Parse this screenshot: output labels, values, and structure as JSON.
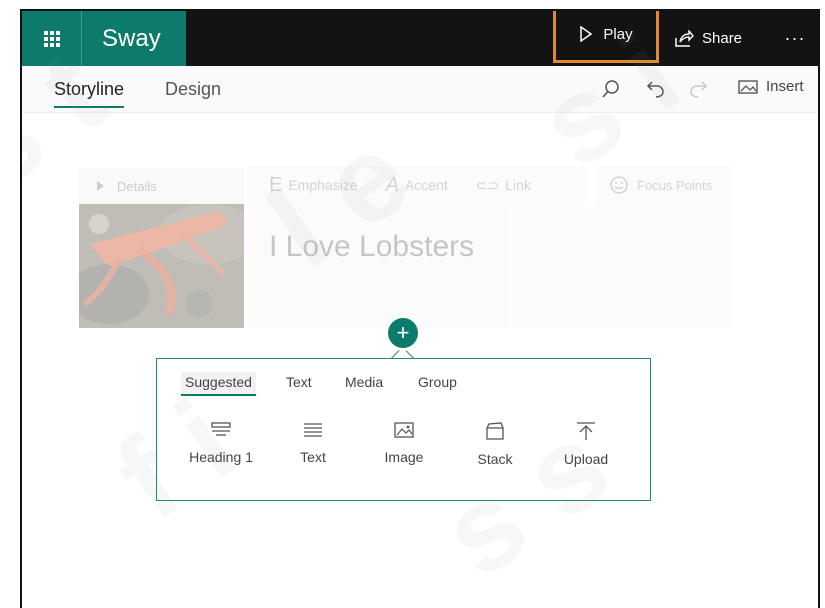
{
  "app": {
    "name": "Sway"
  },
  "topbar": {
    "play_label": "Play",
    "share_label": "Share",
    "more_label": "···"
  },
  "tabs": [
    {
      "label": "Storyline",
      "active": true
    },
    {
      "label": "Design",
      "active": false
    }
  ],
  "toolbar": {
    "icons": [
      "search-icon",
      "undo-icon",
      "redo-icon"
    ],
    "insert_label": "Insert"
  },
  "canvas": {
    "details_label": "Details",
    "format_buttons": [
      {
        "glyph": "E",
        "label": "Emphasize"
      },
      {
        "glyph": "A",
        "label": "Accent"
      },
      {
        "glyph": "⊂⊃",
        "label": "Link"
      }
    ],
    "focus_points_label": "Focus Points",
    "title": "I Love Lobsters"
  },
  "insert_panel": {
    "add_label": "+",
    "tabs": [
      {
        "label": "Suggested",
        "active": true
      },
      {
        "label": "Text",
        "active": false
      },
      {
        "label": "Media",
        "active": false
      },
      {
        "label": "Group",
        "active": false
      }
    ],
    "cards": [
      {
        "label": "Heading 1",
        "icon": "heading-icon"
      },
      {
        "label": "Text",
        "icon": "text-lines-icon"
      },
      {
        "label": "Image",
        "icon": "image-icon"
      },
      {
        "label": "Stack",
        "icon": "stack-icon"
      },
      {
        "label": "Upload",
        "icon": "upload-icon"
      }
    ]
  },
  "colors": {
    "brand": "#0c7b6c",
    "topbar_bg": "#131313",
    "highlight": "#e08a2b"
  }
}
